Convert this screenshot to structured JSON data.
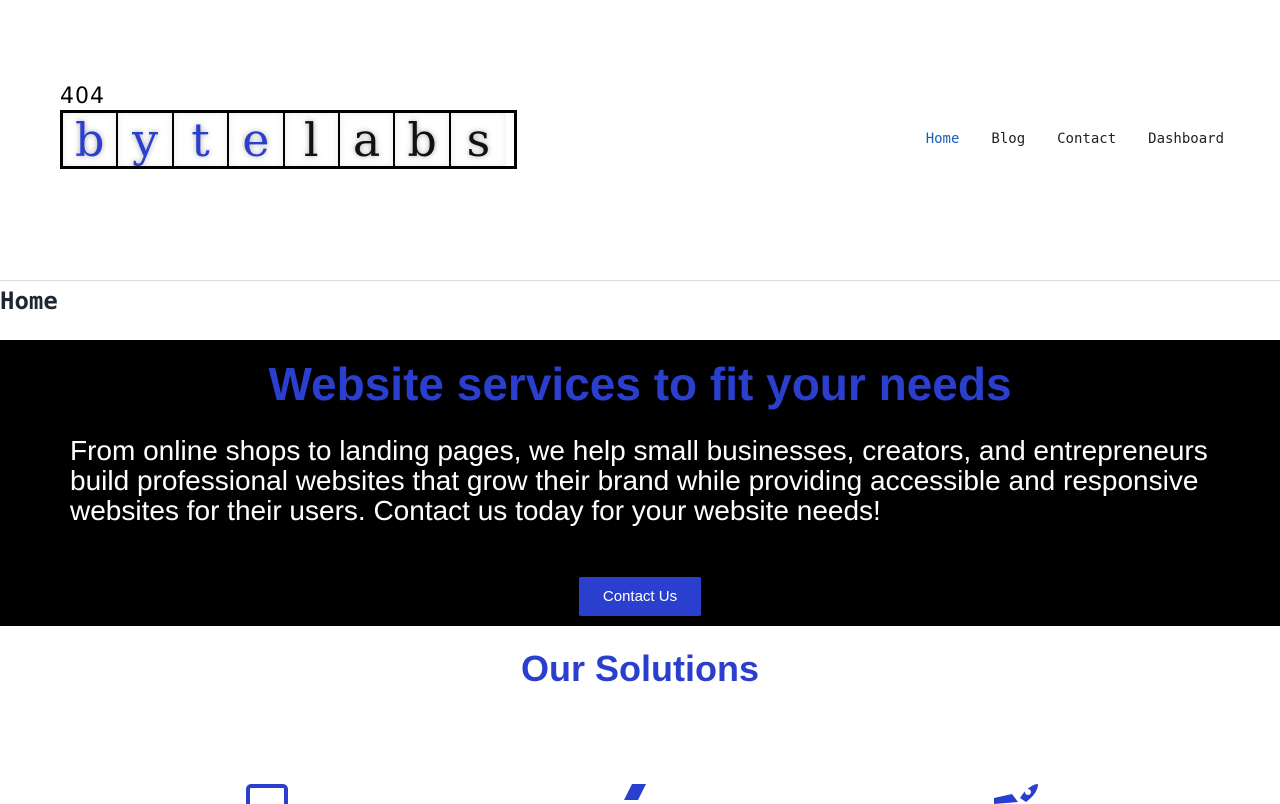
{
  "header": {
    "logo": {
      "top_text": "404",
      "letters": [
        "b",
        "y",
        "t",
        "e",
        "l",
        "a",
        "b",
        "s"
      ]
    },
    "nav": [
      {
        "label": "Home",
        "active": true
      },
      {
        "label": "Blog",
        "active": false
      },
      {
        "label": "Contact",
        "active": false
      },
      {
        "label": "Dashboard",
        "active": false
      }
    ]
  },
  "page_title": "Home",
  "hero": {
    "heading": "Website services to fit your needs",
    "body": "From online shops to landing pages, we help small businesses, creators, and entrepreneurs build professional websites that grow their brand while providing accessible and responsive websites for their users. Contact us today for your website needs!",
    "cta_label": "Contact Us"
  },
  "solutions": {
    "heading": "Our Solutions",
    "icons": [
      "monitor-icon",
      "pen-icon",
      "rocket-icon"
    ]
  },
  "colors": {
    "brand_blue": "#2b3fce",
    "nav_active": "#1a5fb4",
    "hero_bg": "#000000"
  }
}
